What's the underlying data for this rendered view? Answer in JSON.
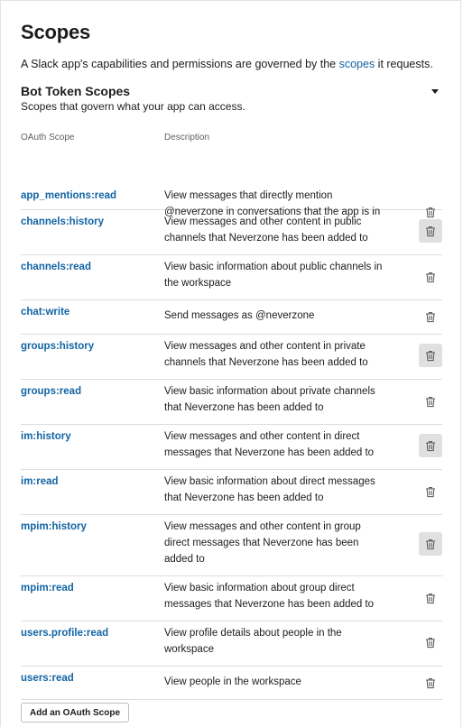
{
  "header": {
    "title": "Scopes",
    "intro_before_link": "A Slack app's capabilities and permissions are governed by the ",
    "intro_link": "scopes",
    "intro_after_link": " it requests."
  },
  "section": {
    "title": "Bot Token Scopes",
    "subtitle": "Scopes that govern what your app can access.",
    "collapse_icon": "caret-down-icon"
  },
  "table": {
    "col_scope": "OAuth Scope",
    "col_desc": "Description",
    "rows": [
      {
        "scope": "app_mentions:read",
        "desc": "View messages that directly mention @neverzone in conversations that the app is in",
        "delete_highlighted": false
      },
      {
        "scope": "channels:history",
        "desc": "View messages and other content in public channels that Neverzone has been added to",
        "delete_highlighted": true
      },
      {
        "scope": "channels:read",
        "desc": "View basic information about public channels in the workspace",
        "delete_highlighted": false
      },
      {
        "scope": "chat:write",
        "desc": "Send messages as @neverzone",
        "delete_highlighted": false
      },
      {
        "scope": "groups:history",
        "desc": "View messages and other content in private channels that Neverzone has been added to",
        "delete_highlighted": true
      },
      {
        "scope": "groups:read",
        "desc": "View basic information about private channels that Neverzone has been added to",
        "delete_highlighted": false
      },
      {
        "scope": "im:history",
        "desc": "View messages and other content in direct messages that Neverzone has been added to",
        "delete_highlighted": true
      },
      {
        "scope": "im:read",
        "desc": "View basic information about direct messages that Neverzone has been added to",
        "delete_highlighted": false
      },
      {
        "scope": "mpim:history",
        "desc": "View messages and other content in group direct messages that Neverzone has been added to",
        "delete_highlighted": true
      },
      {
        "scope": "mpim:read",
        "desc": "View basic information about group direct messages that Neverzone has been added to",
        "delete_highlighted": false
      },
      {
        "scope": "users.profile:read",
        "desc": "View profile details about people in the workspace",
        "delete_highlighted": false
      },
      {
        "scope": "users:read",
        "desc": "View people in the workspace",
        "delete_highlighted": false
      }
    ]
  },
  "actions": {
    "add_scope_label": "Add an OAuth Scope"
  },
  "colors": {
    "link": "#1264a3",
    "text": "#1d1c1d",
    "muted": "#616061",
    "divider": "#dddddd",
    "delete_hover_bg": "#e0e0e0"
  }
}
